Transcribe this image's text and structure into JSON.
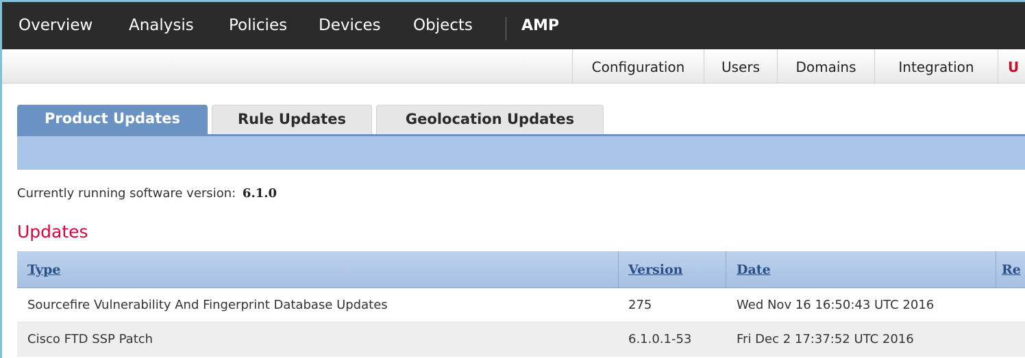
{
  "topnav": {
    "items": [
      {
        "label": "Overview"
      },
      {
        "label": "Analysis"
      },
      {
        "label": "Policies"
      },
      {
        "label": "Devices"
      },
      {
        "label": "Objects"
      },
      {
        "label": "AMP"
      }
    ]
  },
  "subnav": {
    "items": [
      {
        "label": "Configuration"
      },
      {
        "label": "Users"
      },
      {
        "label": "Domains"
      },
      {
        "label": "Integration"
      },
      {
        "label": "U"
      }
    ]
  },
  "tabs": [
    {
      "label": "Product Updates",
      "active": true
    },
    {
      "label": "Rule Updates",
      "active": false
    },
    {
      "label": "Geolocation Updates",
      "active": false
    }
  ],
  "version_info": {
    "label": "Currently running software version:",
    "value": "6.1.0"
  },
  "updates": {
    "title": "Updates",
    "columns": [
      "Type",
      "Version",
      "Date",
      "Re"
    ],
    "rows": [
      {
        "type": "Sourcefire Vulnerability And Fingerprint Database Updates",
        "version": "275",
        "date": "Wed Nov 16 16:50:43 UTC 2016"
      },
      {
        "type": "Cisco FTD SSP Patch",
        "version": "6.1.0.1-53",
        "date": "Fri Dec 2 17:37:52 UTC 2016"
      }
    ]
  },
  "colors": {
    "accent_red": "#e0003a",
    "tab_active": "#6a93c4",
    "header_link": "#2a4f86"
  }
}
